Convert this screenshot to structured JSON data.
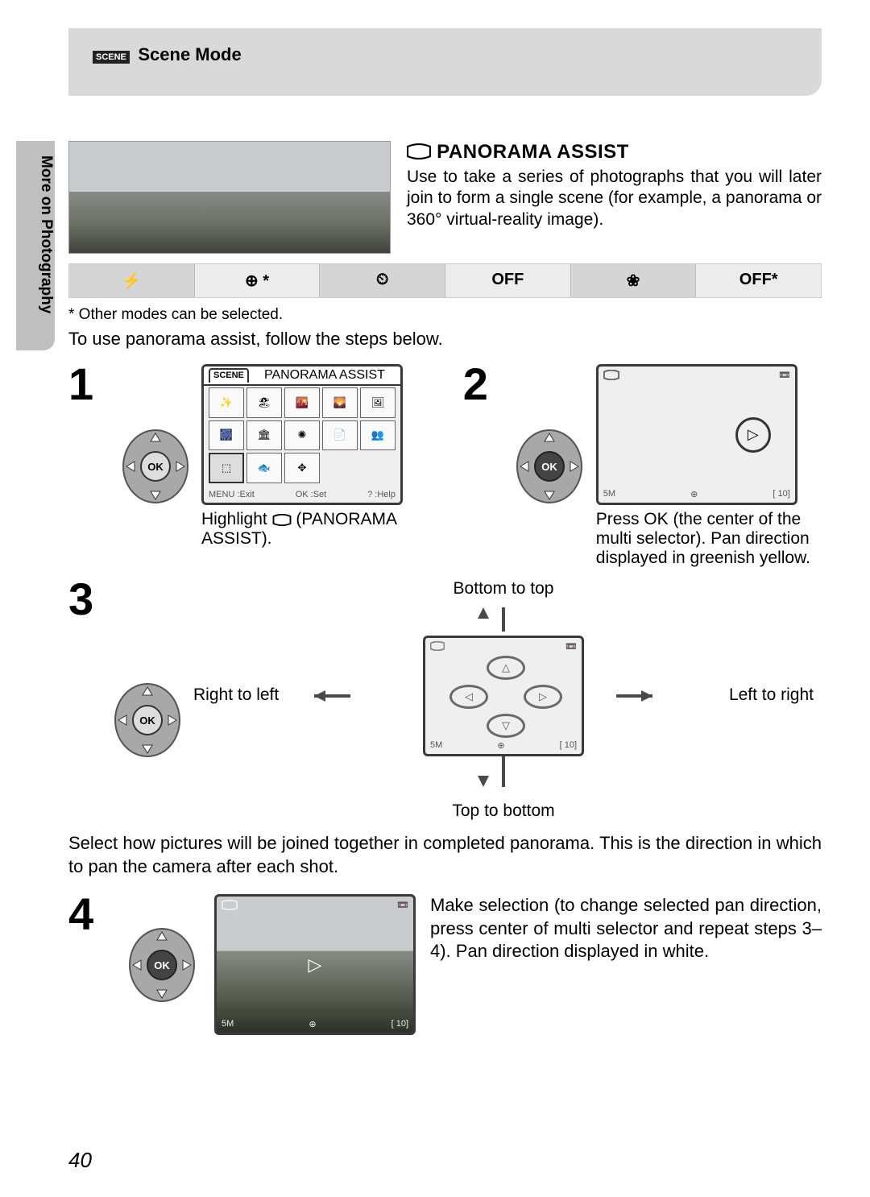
{
  "header": {
    "badge": "SCENE",
    "title": "Scene Mode"
  },
  "sidetab": "More on Photography",
  "feature": {
    "icon": "⬚",
    "title": "PANORAMA ASSIST",
    "desc": "Use to take a series of photographs that you will later join to form a single scene (for example, a panorama or 360° virtual-reality image)."
  },
  "settings": [
    "⚡",
    "⊕ *",
    "⏲",
    "OFF",
    "❀",
    "OFF*"
  ],
  "note": "* Other modes can be selected.",
  "intro_line": "To use panorama assist, follow the steps below.",
  "step1": {
    "num": "1",
    "screen_title": "PANORAMA ASSIST",
    "screen_tab": "SCENE",
    "footer": {
      "exit": "MENU :Exit",
      "set": "OK :Set",
      "help": "? :Help"
    },
    "caption_a": "Highlight ",
    "caption_b": " (PANORAMA ASSIST)."
  },
  "step2": {
    "num": "2",
    "status": {
      "size": "5M",
      "remain": "[  10]"
    },
    "caption": "Press OK (the center of the multi selector). Pan direction displayed in greenish yellow."
  },
  "step3": {
    "num": "3",
    "labels": {
      "top": "Bottom to top",
      "right": "Left to right",
      "bottom": "Top to bottom",
      "left": "Right to left"
    },
    "status": {
      "size": "5M",
      "remain": "[  10]"
    },
    "caption": "Select how pictures will be joined together in completed panorama. This is the direction in which to pan the camera after each shot."
  },
  "step4": {
    "num": "4",
    "status": {
      "size": "5M",
      "remain": "[  10]"
    },
    "text": "Make selection (to change selected pan direction, press center of multi selector and repeat steps 3–4). Pan direction displayed in white."
  },
  "pagenum": "40"
}
